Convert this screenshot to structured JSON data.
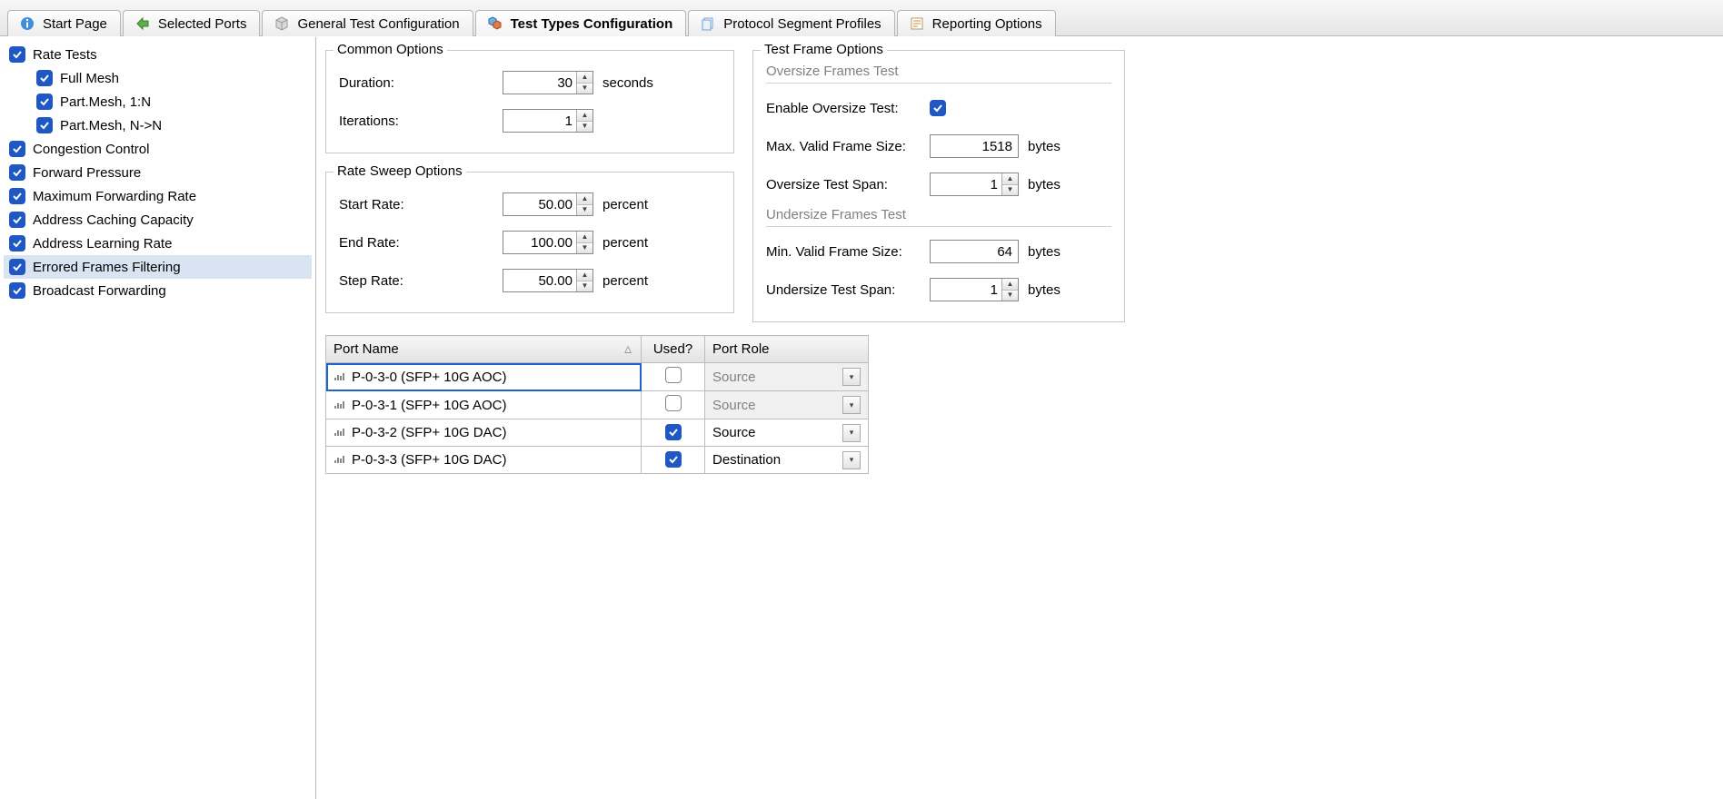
{
  "tabs": [
    {
      "id": "start",
      "label": "Start Page"
    },
    {
      "id": "ports",
      "label": "Selected Ports"
    },
    {
      "id": "general",
      "label": "General Test Configuration"
    },
    {
      "id": "types",
      "label": "Test Types Configuration",
      "active": true
    },
    {
      "id": "profiles",
      "label": "Protocol Segment Profiles"
    },
    {
      "id": "report",
      "label": "Reporting Options"
    }
  ],
  "tree": [
    {
      "label": "Rate Tests",
      "checked": true,
      "indent": 0
    },
    {
      "label": "Full Mesh",
      "checked": true,
      "indent": 1
    },
    {
      "label": "Part.Mesh, 1:N",
      "checked": true,
      "indent": 1
    },
    {
      "label": "Part.Mesh, N->N",
      "checked": true,
      "indent": 1
    },
    {
      "label": "Congestion Control",
      "checked": true,
      "indent": 0
    },
    {
      "label": "Forward Pressure",
      "checked": true,
      "indent": 0
    },
    {
      "label": "Maximum Forwarding Rate",
      "checked": true,
      "indent": 0
    },
    {
      "label": "Address Caching Capacity",
      "checked": true,
      "indent": 0
    },
    {
      "label": "Address Learning Rate",
      "checked": true,
      "indent": 0
    },
    {
      "label": "Errored Frames Filtering",
      "checked": true,
      "indent": 0,
      "selected": true
    },
    {
      "label": "Broadcast Forwarding",
      "checked": true,
      "indent": 0
    }
  ],
  "common": {
    "legend": "Common Options",
    "duration_label": "Duration:",
    "duration_value": "30",
    "duration_unit": "seconds",
    "iter_label": "Iterations:",
    "iter_value": "1"
  },
  "sweep": {
    "legend": "Rate Sweep Options",
    "start_label": "Start Rate:",
    "start_value": "50.00",
    "start_unit": "percent",
    "end_label": "End Rate:",
    "end_value": "100.00",
    "end_unit": "percent",
    "step_label": "Step Rate:",
    "step_value": "50.00",
    "step_unit": "percent"
  },
  "frame": {
    "legend": "Test Frame Options",
    "over_title": "Oversize Frames Test",
    "enable_label": "Enable Oversize Test:",
    "enable_checked": true,
    "max_label": "Max. Valid Frame Size:",
    "max_value": "1518",
    "max_unit": "bytes",
    "ospan_label": "Oversize Test Span:",
    "ospan_value": "1",
    "ospan_unit": "bytes",
    "under_title": "Undersize Frames Test",
    "min_label": "Min. Valid Frame Size:",
    "min_value": "64",
    "min_unit": "bytes",
    "uspan_label": "Undersize Test Span:",
    "uspan_value": "1",
    "uspan_unit": "bytes"
  },
  "table": {
    "headers": {
      "name": "Port Name",
      "used": "Used?",
      "role": "Port Role"
    },
    "rows": [
      {
        "name": "P-0-3-0 (SFP+ 10G AOC)",
        "used": false,
        "role": "Source",
        "disabled": true,
        "selected": true
      },
      {
        "name": "P-0-3-1 (SFP+ 10G AOC)",
        "used": false,
        "role": "Source",
        "disabled": true
      },
      {
        "name": "P-0-3-2 (SFP+ 10G DAC)",
        "used": true,
        "role": "Source"
      },
      {
        "name": "P-0-3-3 (SFP+ 10G DAC)",
        "used": true,
        "role": "Destination"
      }
    ]
  }
}
